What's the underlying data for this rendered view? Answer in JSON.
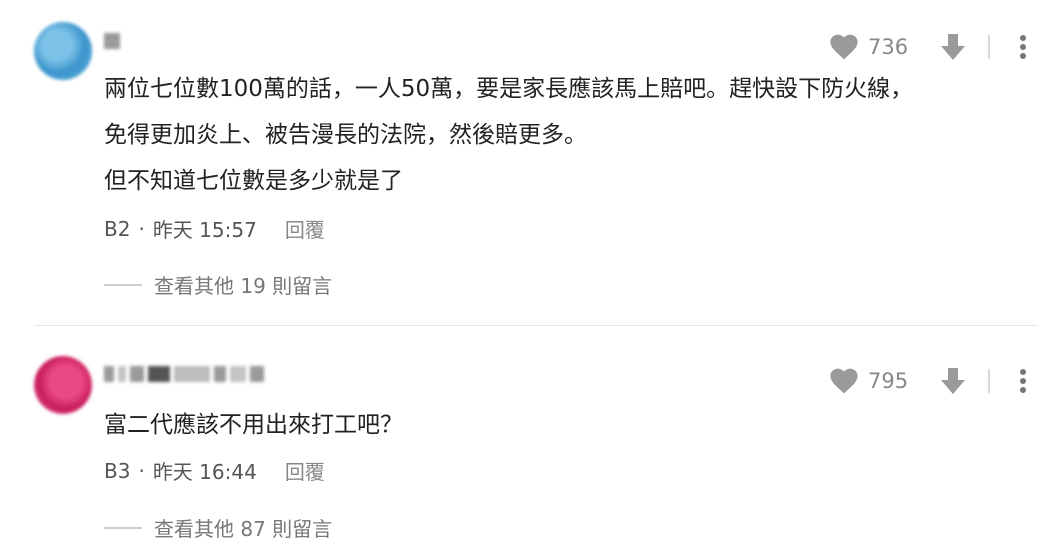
{
  "comments": [
    {
      "likes": "736",
      "lines": [
        "兩位七位數100萬的話，一人50萬，要是家長應該馬上賠吧。趕快設下防火線，",
        "免得更加炎上、被告漫長的法院，然後賠更多。",
        "但不知道七位數是多少就是了"
      ],
      "floor": "B2",
      "dot": "·",
      "time": "昨天 15:57",
      "reply_label": "回覆",
      "more_replies": "查看其他 19 則留言"
    },
    {
      "likes": "795",
      "lines": [
        "富二代應該不用出來打工吧？"
      ],
      "floor": "B3",
      "dot": "·",
      "time": "昨天 16:44",
      "reply_label": "回覆",
      "more_replies": "查看其他 87 則留言"
    }
  ],
  "icons": {
    "like": "heart-icon",
    "dislike": "thumb-down-arrow-icon",
    "more": "more-vertical-icon"
  },
  "colors": {
    "icon_gray": "#9a9a9a",
    "text": "#222222",
    "muted": "#888888"
  }
}
